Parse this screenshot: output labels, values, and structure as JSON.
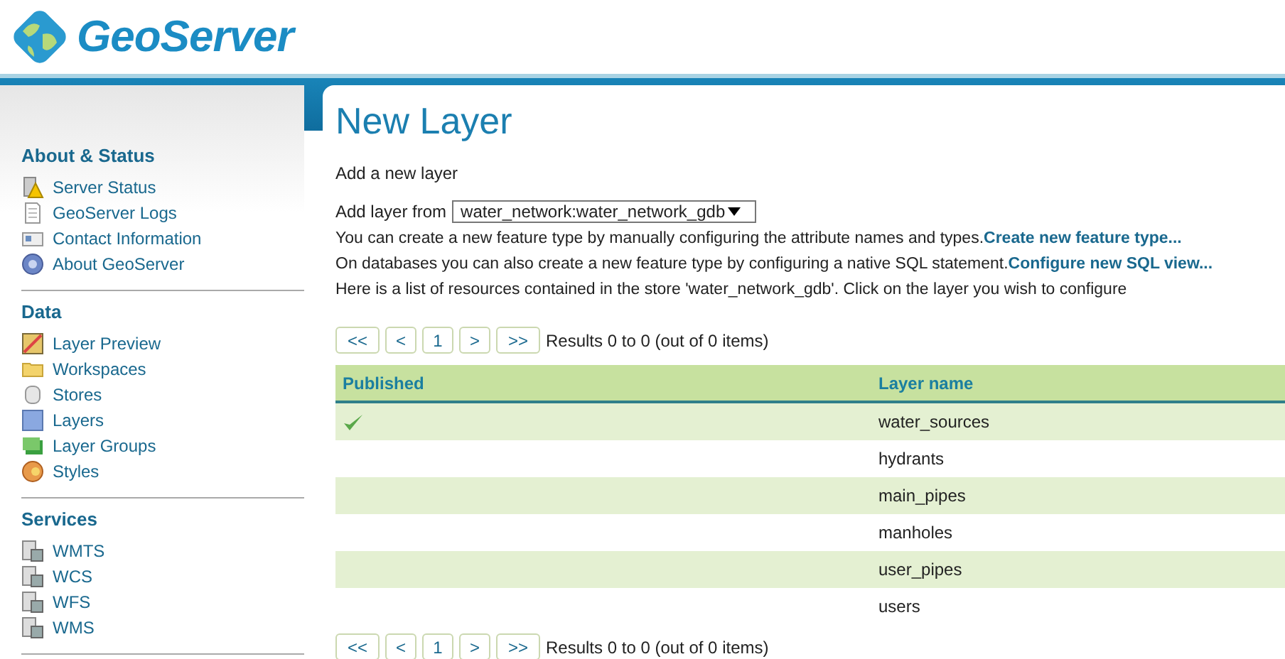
{
  "header": {
    "logo_text": "GeoServer"
  },
  "sidebar": {
    "sections": [
      {
        "title": "About & Status",
        "items": [
          {
            "label": "Server Status"
          },
          {
            "label": "GeoServer Logs"
          },
          {
            "label": "Contact Information"
          },
          {
            "label": "About GeoServer"
          }
        ]
      },
      {
        "title": "Data",
        "items": [
          {
            "label": "Layer Preview"
          },
          {
            "label": "Workspaces"
          },
          {
            "label": "Stores"
          },
          {
            "label": "Layers"
          },
          {
            "label": "Layer Groups"
          },
          {
            "label": "Styles"
          }
        ]
      },
      {
        "title": "Services",
        "items": [
          {
            "label": "WMTS"
          },
          {
            "label": "WCS"
          },
          {
            "label": "WFS"
          },
          {
            "label": "WMS"
          }
        ]
      }
    ]
  },
  "page": {
    "title": "New Layer",
    "subtitle": "Add a new layer",
    "store_select": {
      "label": "Add layer from",
      "value": "water_network:water_network_gdb"
    },
    "lines": [
      {
        "text": "You can create a new feature type by manually configuring the attribute names and types.",
        "link": "Create new feature type..."
      },
      {
        "text": "On databases you can also create a new feature type by configuring a native SQL statement.",
        "link": "Configure new SQL view..."
      },
      {
        "text": "Here is a list of resources contained in the store 'water_network_gdb'. Click on the layer you wish to configure"
      }
    ]
  },
  "pager_top": {
    "buttons": [
      "<<",
      "<",
      "1",
      ">",
      ">>"
    ],
    "summary": "Results 0 to 0 (out of 0 items)"
  },
  "table": {
    "columns": [
      "Published",
      "Layer name"
    ],
    "rows": [
      {
        "published": true,
        "layer_name": "water_sources"
      },
      {
        "published": false,
        "layer_name": "hydrants"
      },
      {
        "published": false,
        "layer_name": "main_pipes"
      },
      {
        "published": false,
        "layer_name": "manholes"
      },
      {
        "published": false,
        "layer_name": "user_pipes"
      },
      {
        "published": false,
        "layer_name": "users"
      }
    ]
  },
  "pager_bottom": {
    "buttons": [
      "<<",
      "<",
      "1",
      ">",
      ">>"
    ],
    "summary": "Results 0 to 0 (out of 0 items)"
  }
}
